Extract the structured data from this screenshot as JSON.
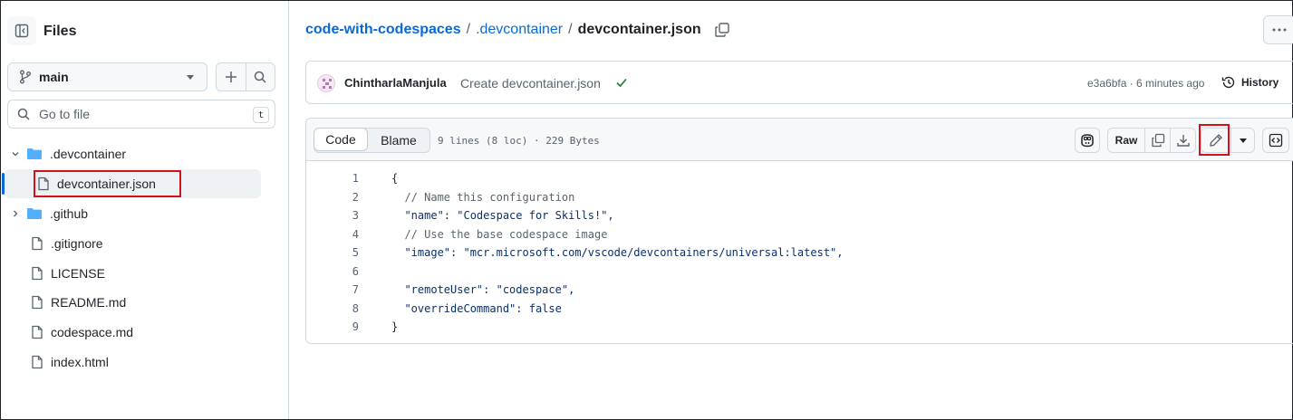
{
  "sidebar": {
    "title": "Files",
    "branch": "main",
    "search_placeholder": "Go to file",
    "search_shortcut": "t",
    "tree": [
      {
        "name": ".devcontainer",
        "type": "folder",
        "expanded": true
      },
      {
        "name": "devcontainer.json",
        "type": "file",
        "selected": true
      },
      {
        "name": ".github",
        "type": "folder",
        "expanded": false
      },
      {
        "name": ".gitignore",
        "type": "file"
      },
      {
        "name": "LICENSE",
        "type": "file"
      },
      {
        "name": "README.md",
        "type": "file"
      },
      {
        "name": "codespace.md",
        "type": "file"
      },
      {
        "name": "index.html",
        "type": "file"
      }
    ]
  },
  "breadcrumb": {
    "repo": "code-with-codespaces",
    "sep1": "/",
    "folder": ".devcontainer",
    "sep2": "/",
    "file": "devcontainer.json"
  },
  "commit": {
    "author": "ChintharlaManjula",
    "message": "Create devcontainer.json",
    "sha_time": "e3a6bfa · 6 minutes ago",
    "history_label": "History"
  },
  "file_header": {
    "code_tab": "Code",
    "blame_tab": "Blame",
    "meta": "9 lines (8 loc) · 229 Bytes",
    "raw_label": "Raw"
  },
  "code_lines": [
    {
      "num": "1",
      "text": "{"
    },
    {
      "num": "2",
      "text": "  // Name this configuration"
    },
    {
      "num": "3",
      "text": "  \"name\": \"Codespace for Skills!\","
    },
    {
      "num": "4",
      "text": "  // Use the base codespace image"
    },
    {
      "num": "5",
      "text": "  \"image\": \"mcr.microsoft.com/vscode/devcontainers/universal:latest\","
    },
    {
      "num": "6",
      "text": ""
    },
    {
      "num": "7",
      "text": "  \"remoteUser\": \"codespace\","
    },
    {
      "num": "8",
      "text": "  \"overrideCommand\": false"
    },
    {
      "num": "9",
      "text": "}"
    }
  ],
  "colors": {
    "link": "#0969da",
    "highlight": "#d0121b",
    "success": "#1a7f37"
  }
}
